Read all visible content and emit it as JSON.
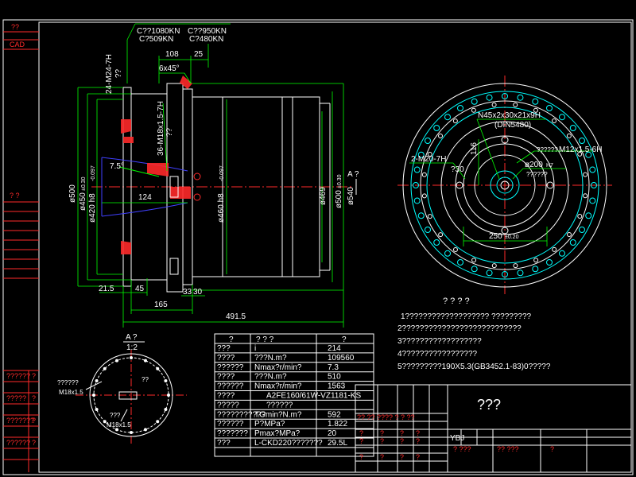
{
  "side_panel": {
    "top_label_1": "??",
    "top_label_2": "CAD",
    "mid_label": "?      ?",
    "rows": [
      "??????",
      "?????",
      "???????",
      "??????"
    ],
    "row_marks": [
      "?",
      "?",
      "?",
      "?"
    ]
  },
  "front_view": {
    "load_1": "C??1080KN",
    "load_2": "C?509KN",
    "load_3": "C??950KN",
    "load_4": "C?480KN",
    "dim_108": "108",
    "dim_25": "25",
    "dim_chamfer": "6x45°",
    "thread_1": "24-M24-7H",
    "thread_1_q": "??",
    "thread_2": "36-M18x1.5-7H",
    "thread_2_q": "??",
    "angle": "7.5°",
    "dim_124": "124",
    "dia_500": "ø500",
    "dia_500_tol": "±0.30",
    "dia_420": "ø420  h8",
    "dia_420_tol": "-0.097",
    "dia_450": "ø450",
    "dia_450_tol": "±0.30",
    "dia_460": "ø460  h8",
    "dia_460_tol": "-0.097",
    "dia_469": "ø469",
    "dia_500b": "ø500",
    "dia_500b_tol": "±0.30",
    "dia_540": "ø540",
    "section": "A  ?",
    "dim_21_5": "21.5",
    "dim_45": "45",
    "dim_33": "33",
    "dim_30": "30",
    "dim_165": "165",
    "dim_491_5": "491.5"
  },
  "side_view": {
    "spline": "N45x2x30x21x9H",
    "spline_std": "(DIN5480)",
    "callout_1": "??????",
    "thread_3": "M12x1.5-6H",
    "thread_4": "2-M20-7H",
    "thread_4_q": "?30",
    "dia_200": "ø200",
    "dia_200_fit": "H7",
    "dia_200_q": "??????",
    "dim_116": "116",
    "dim_250": "250",
    "dim_250_tol": "±0.20"
  },
  "notes": {
    "title": "?  ?  ?  ?",
    "lines": [
      "1???????????????????  ?????????",
      "2???????????????????????????",
      "3??????????????????",
      "4?????????????????",
      "5?????????190X5.3(GB3452.1-83)0?????"
    ]
  },
  "detail_view": {
    "title": "A  ?",
    "scale": "1:2",
    "label_1": "??????",
    "thread_1": "M18x1.5",
    "label_2": "??",
    "label_3": "???",
    "thread_2": "M18x1.5"
  },
  "spec_table": {
    "header": [
      "?",
      "?   ?   ?",
      "?"
    ],
    "rows": [
      [
        "???",
        "i",
        "214"
      ],
      [
        "????",
        "???N.m?",
        "109560"
      ],
      [
        "??????",
        "Nmax?r/min?",
        "7.3"
      ],
      [
        "????",
        "???N.m?",
        "510"
      ],
      [
        "??????",
        "Nmax?r/min?",
        "1563"
      ],
      [
        "????",
        "A2FE160/61W-VZ1181-KS",
        ""
      ],
      [
        "?????",
        "??????",
        ""
      ],
      [
        "???????????",
        "TGmin?N.m?",
        "592"
      ],
      [
        "??????",
        "P?MPa?",
        "1.822"
      ],
      [
        "???????",
        "Pmax?MPa?",
        "20"
      ],
      [
        "???",
        "L-CKD220???????",
        "29.5L"
      ]
    ]
  },
  "title_block": {
    "name": "???",
    "sign_row": "?? ??  ????   ?    ?  ??",
    "material": "YBJ",
    "weight_label": "?  ???",
    "scale_label": "?? ???",
    "sheet_mark": "?",
    "cells": [
      "?",
      "?",
      "?",
      "?",
      "?",
      "?",
      "?",
      "?",
      "?",
      "?",
      "?",
      "?"
    ]
  },
  "colors": {
    "frame": "#ffffff",
    "outline": "#ffffff",
    "dimension": "#00ff00",
    "center": "#ff2a2a",
    "hidden": "#ffff00",
    "cyan": "#00ffff",
    "blue": "#4040ff",
    "section_fill": "#ff2a2a"
  }
}
